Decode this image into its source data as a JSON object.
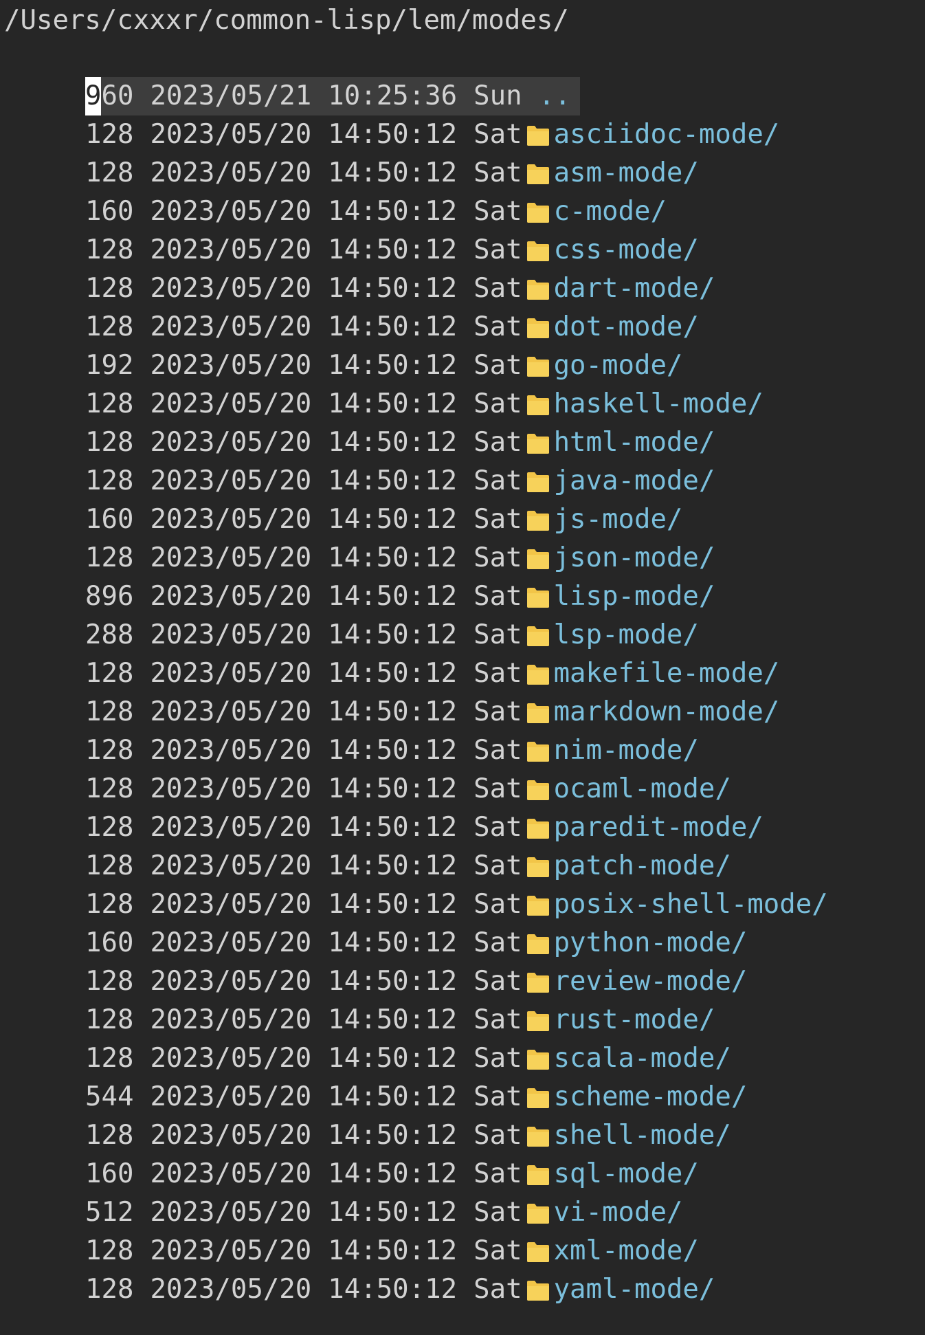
{
  "window": {
    "path": "/Users/cxxxr/common-lisp/lem/modes/"
  },
  "colors": {
    "background": "#262626",
    "text": "#d2d2d2",
    "directory": "#7bbfdc",
    "folder_icon": "#f2c548",
    "current_line": "#3d3d3d"
  },
  "parent_entry": {
    "size_first_char": "9",
    "size_rest": "60",
    "date": "2023/05/21",
    "time": "10:25:36",
    "weekday": "Sun",
    "name": ".."
  },
  "entries": [
    {
      "size": "128",
      "date": "2023/05/20",
      "time": "14:50:12",
      "weekday": "Sat",
      "icon": "folder-icon",
      "name": "asciidoc-mode/"
    },
    {
      "size": "128",
      "date": "2023/05/20",
      "time": "14:50:12",
      "weekday": "Sat",
      "icon": "folder-icon",
      "name": "asm-mode/"
    },
    {
      "size": "160",
      "date": "2023/05/20",
      "time": "14:50:12",
      "weekday": "Sat",
      "icon": "folder-icon",
      "name": "c-mode/"
    },
    {
      "size": "128",
      "date": "2023/05/20",
      "time": "14:50:12",
      "weekday": "Sat",
      "icon": "folder-icon",
      "name": "css-mode/"
    },
    {
      "size": "128",
      "date": "2023/05/20",
      "time": "14:50:12",
      "weekday": "Sat",
      "icon": "folder-icon",
      "name": "dart-mode/"
    },
    {
      "size": "128",
      "date": "2023/05/20",
      "time": "14:50:12",
      "weekday": "Sat",
      "icon": "folder-icon",
      "name": "dot-mode/"
    },
    {
      "size": "192",
      "date": "2023/05/20",
      "time": "14:50:12",
      "weekday": "Sat",
      "icon": "folder-icon",
      "name": "go-mode/"
    },
    {
      "size": "128",
      "date": "2023/05/20",
      "time": "14:50:12",
      "weekday": "Sat",
      "icon": "folder-icon",
      "name": "haskell-mode/"
    },
    {
      "size": "128",
      "date": "2023/05/20",
      "time": "14:50:12",
      "weekday": "Sat",
      "icon": "folder-icon",
      "name": "html-mode/"
    },
    {
      "size": "128",
      "date": "2023/05/20",
      "time": "14:50:12",
      "weekday": "Sat",
      "icon": "folder-icon",
      "name": "java-mode/"
    },
    {
      "size": "160",
      "date": "2023/05/20",
      "time": "14:50:12",
      "weekday": "Sat",
      "icon": "folder-icon",
      "name": "js-mode/"
    },
    {
      "size": "128",
      "date": "2023/05/20",
      "time": "14:50:12",
      "weekday": "Sat",
      "icon": "folder-icon",
      "name": "json-mode/"
    },
    {
      "size": "896",
      "date": "2023/05/20",
      "time": "14:50:12",
      "weekday": "Sat",
      "icon": "folder-icon",
      "name": "lisp-mode/"
    },
    {
      "size": "288",
      "date": "2023/05/20",
      "time": "14:50:12",
      "weekday": "Sat",
      "icon": "folder-icon",
      "name": "lsp-mode/"
    },
    {
      "size": "128",
      "date": "2023/05/20",
      "time": "14:50:12",
      "weekday": "Sat",
      "icon": "folder-icon",
      "name": "makefile-mode/"
    },
    {
      "size": "128",
      "date": "2023/05/20",
      "time": "14:50:12",
      "weekday": "Sat",
      "icon": "folder-icon",
      "name": "markdown-mode/"
    },
    {
      "size": "128",
      "date": "2023/05/20",
      "time": "14:50:12",
      "weekday": "Sat",
      "icon": "folder-icon",
      "name": "nim-mode/"
    },
    {
      "size": "128",
      "date": "2023/05/20",
      "time": "14:50:12",
      "weekday": "Sat",
      "icon": "folder-icon",
      "name": "ocaml-mode/"
    },
    {
      "size": "128",
      "date": "2023/05/20",
      "time": "14:50:12",
      "weekday": "Sat",
      "icon": "folder-icon",
      "name": "paredit-mode/"
    },
    {
      "size": "128",
      "date": "2023/05/20",
      "time": "14:50:12",
      "weekday": "Sat",
      "icon": "folder-icon",
      "name": "patch-mode/"
    },
    {
      "size": "128",
      "date": "2023/05/20",
      "time": "14:50:12",
      "weekday": "Sat",
      "icon": "folder-icon",
      "name": "posix-shell-mode/"
    },
    {
      "size": "160",
      "date": "2023/05/20",
      "time": "14:50:12",
      "weekday": "Sat",
      "icon": "folder-icon",
      "name": "python-mode/"
    },
    {
      "size": "128",
      "date": "2023/05/20",
      "time": "14:50:12",
      "weekday": "Sat",
      "icon": "folder-icon",
      "name": "review-mode/"
    },
    {
      "size": "128",
      "date": "2023/05/20",
      "time": "14:50:12",
      "weekday": "Sat",
      "icon": "folder-icon",
      "name": "rust-mode/"
    },
    {
      "size": "128",
      "date": "2023/05/20",
      "time": "14:50:12",
      "weekday": "Sat",
      "icon": "folder-icon",
      "name": "scala-mode/"
    },
    {
      "size": "544",
      "date": "2023/05/20",
      "time": "14:50:12",
      "weekday": "Sat",
      "icon": "folder-icon",
      "name": "scheme-mode/"
    },
    {
      "size": "128",
      "date": "2023/05/20",
      "time": "14:50:12",
      "weekday": "Sat",
      "icon": "folder-icon",
      "name": "shell-mode/"
    },
    {
      "size": "160",
      "date": "2023/05/20",
      "time": "14:50:12",
      "weekday": "Sat",
      "icon": "folder-icon",
      "name": "sql-mode/"
    },
    {
      "size": "512",
      "date": "2023/05/20",
      "time": "14:50:12",
      "weekday": "Sat",
      "icon": "folder-icon",
      "name": "vi-mode/"
    },
    {
      "size": "128",
      "date": "2023/05/20",
      "time": "14:50:12",
      "weekday": "Sat",
      "icon": "folder-icon",
      "name": "xml-mode/"
    },
    {
      "size": "128",
      "date": "2023/05/20",
      "time": "14:50:12",
      "weekday": "Sat",
      "icon": "folder-icon",
      "name": "yaml-mode/"
    }
  ]
}
